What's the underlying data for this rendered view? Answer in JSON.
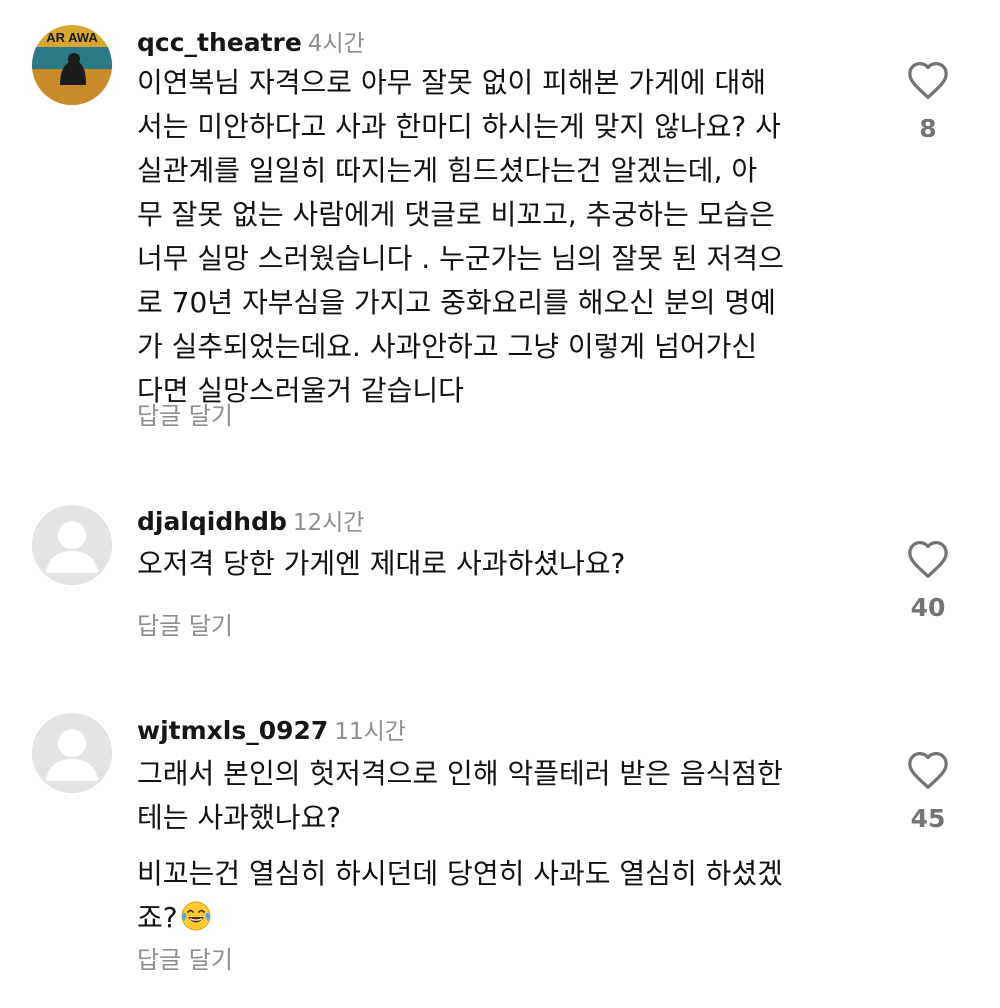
{
  "reply_label": "답글 달기",
  "comments": [
    {
      "username": "qcc_theatre",
      "time": "4시간",
      "avatar_text": "AR AWA",
      "lines": [
        "이연복님 자격으로 아무 잘못 없이 피해본 가게에 대해",
        "서는 미안하다고 사과 한마디 하시는게 맞지 않나요? 사",
        "실관계를 일일히 따지는게 힘드셨다는건 알겠는데,  아",
        "무 잘못 없는 사람에게 댓글로 비꼬고, 추궁하는 모습은",
        "너무 실망 스러웠습니다 . 누군가는 님의 잘못 된 저격으",
        "로 70년 자부심을 가지고 중화요리를 해오신  분의 명예",
        "가 실추되었는데요.  사과안하고 그냥 이렇게 넘어가신",
        "다면 실망스러울거 같습니다"
      ],
      "likes": "8"
    },
    {
      "username": "djalqidhdb",
      "time": "12시간",
      "lines": [
        "오저격 당한 가게엔 제대로 사과하셨나요?"
      ],
      "likes": "40"
    },
    {
      "username": "wjtmxls_0927",
      "time": "11시간",
      "para1": [
        "그래서 본인의 헛저격으로 인해 악플테러 받은 음식점한",
        "테는 사과했나요?"
      ],
      "para2": [
        "비꼬는건 열심히 하시던데 당연히 사과도 열심히 하셨겠",
        "죠?"
      ],
      "emoji": "face-with-tears-of-joy",
      "likes": "45"
    }
  ],
  "icons": {
    "like": "heart-outline-icon",
    "avatar_default": "default-user-icon"
  },
  "colors": {
    "text": "#121212",
    "muted": "#8e8e8e",
    "like_count": "#737373",
    "avatar_bg": "#e3e3e3"
  }
}
